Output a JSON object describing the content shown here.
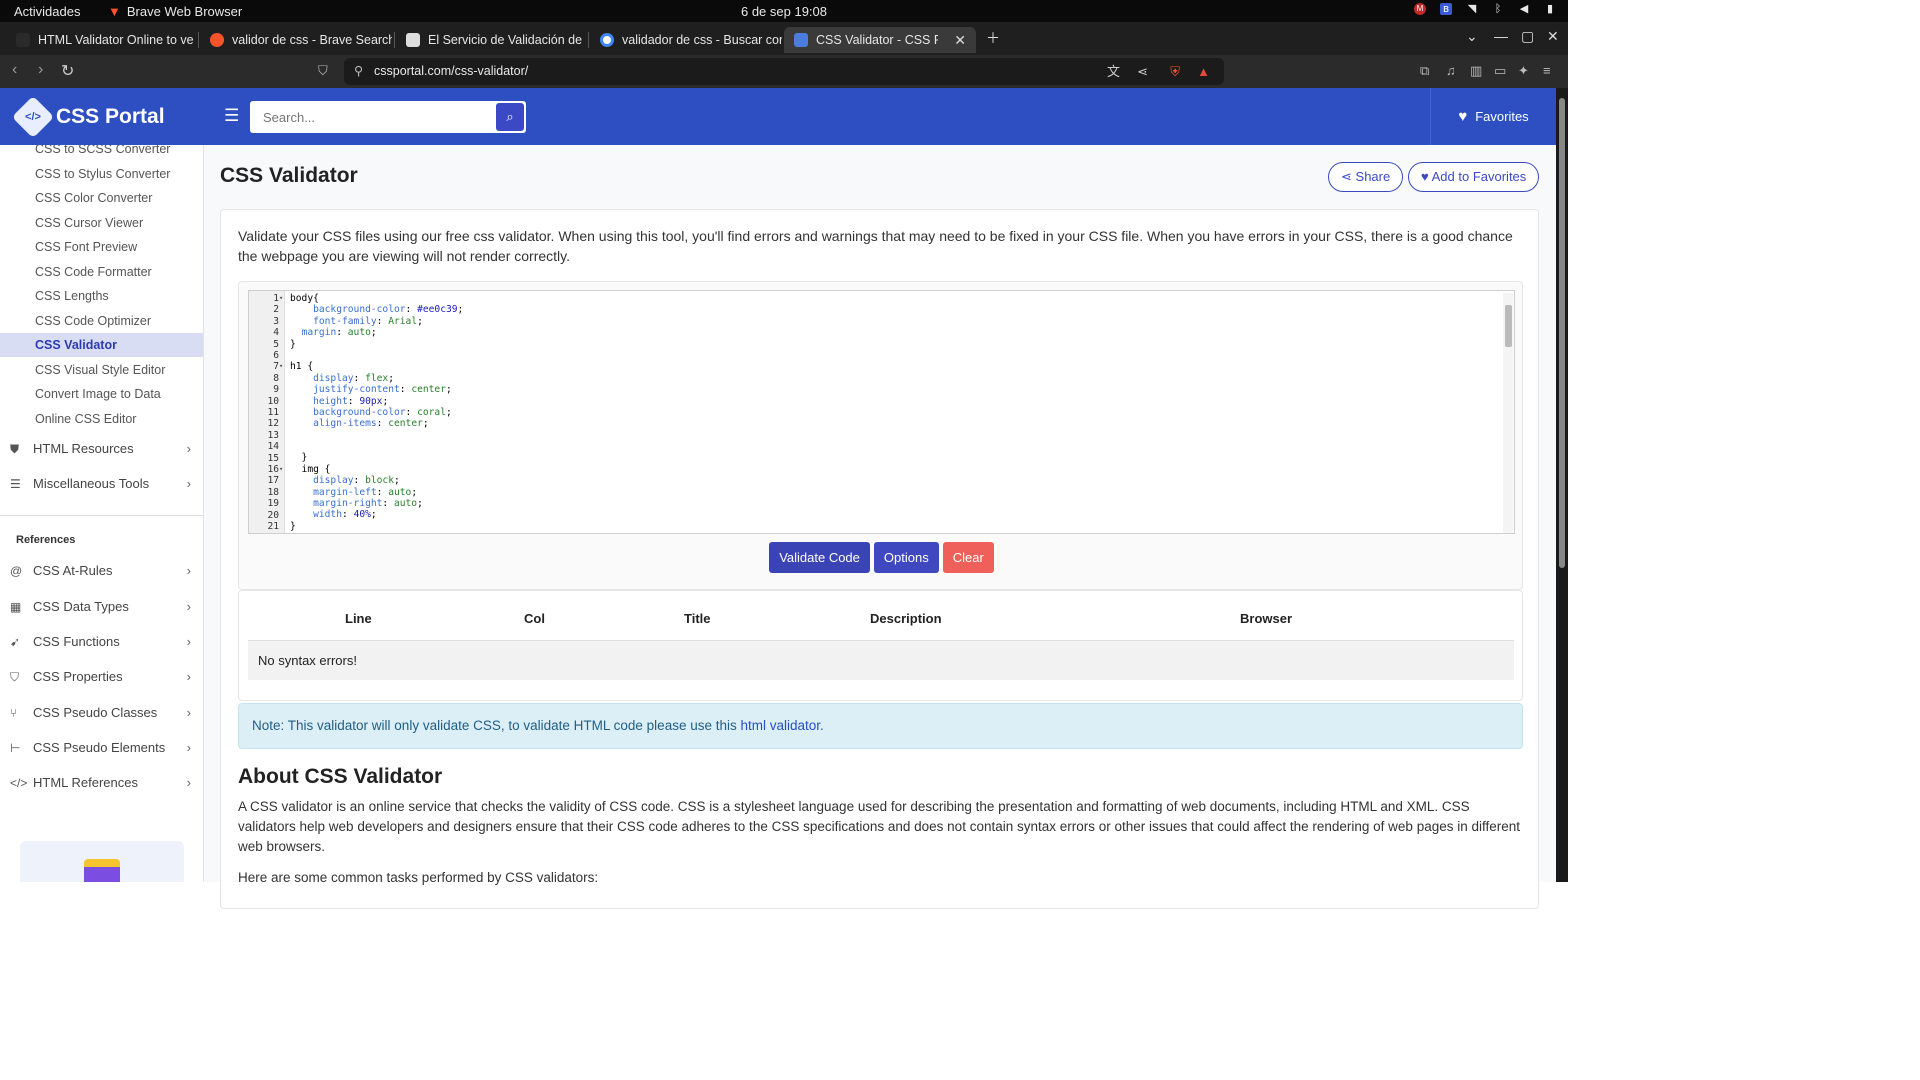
{
  "system": {
    "activities": "Actividades",
    "app_name": "Brave Web Browser",
    "clock": "6 de sep  19:08"
  },
  "tabs": [
    {
      "label": "HTML Validator Online to ve",
      "icon_color": "#e44d26"
    },
    {
      "label": "validor de css - Brave Search",
      "icon_color": "#fb542b"
    },
    {
      "label": "El Servicio de Validación de",
      "icon_color": "#dddddd"
    },
    {
      "label": "validador de css - Buscar cor",
      "icon_color": "#4285f4"
    },
    {
      "label": "CSS Validator - CSS Portal",
      "icon_color": "#4d7ce0",
      "active": true
    }
  ],
  "address": {
    "url": "cssportal.com/css-validator/"
  },
  "header": {
    "brand": "CSS Portal",
    "search_placeholder": "Search...",
    "favorites": "Favorites"
  },
  "sidebar": {
    "items": [
      "CSS to SCSS Converter",
      "CSS to Stylus Converter",
      "CSS Color Converter",
      "CSS Cursor Viewer",
      "CSS Font Preview",
      "CSS Code Formatter",
      "CSS Lengths",
      "CSS Code Optimizer",
      "CSS Validator",
      "CSS Visual Style Editor",
      "Convert Image to Data",
      "Online CSS Editor"
    ],
    "groups": [
      {
        "label": "HTML Resources",
        "icon": "html5-icon"
      },
      {
        "label": "Miscellaneous Tools",
        "icon": "list-icon"
      }
    ],
    "references_heading": "References",
    "references": [
      {
        "label": "CSS At-Rules",
        "icon": "at-icon"
      },
      {
        "label": "CSS Data Types",
        "icon": "table-icon"
      },
      {
        "label": "CSS Functions",
        "icon": "function-icon"
      },
      {
        "label": "CSS Properties",
        "icon": "css3-icon"
      },
      {
        "label": "CSS Pseudo Classes",
        "icon": "branch-icon"
      },
      {
        "label": "CSS Pseudo Elements",
        "icon": "sitemap-icon"
      },
      {
        "label": "HTML References",
        "icon": "code-icon"
      }
    ]
  },
  "page": {
    "title": "CSS Validator",
    "share": "Share",
    "add_favorites": "Add to Favorites",
    "intro": "Validate your CSS files using our free css validator. When using this tool, you'll find errors and warnings that may need to be fixed in your CSS file. When you have errors in your CSS, there is a good chance the webpage you are viewing will not render correctly.",
    "buttons": {
      "validate": "Validate Code",
      "options": "Options",
      "clear": "Clear"
    },
    "table": {
      "headers": [
        "Line",
        "Col",
        "Title",
        "Description",
        "Browser"
      ],
      "empty_message": "No syntax errors!"
    },
    "note_prefix": "Note: This validator will only validate CSS, to validate HTML code please use this ",
    "note_link": "html validator",
    "note_suffix": ".",
    "about_title": "About CSS Validator",
    "about_text": "A CSS validator is an online service that checks the validity of CSS code. CSS is a stylesheet language used for describing the presentation and formatting of web documents, including HTML and XML. CSS validators help web developers and designers ensure that their CSS code adheres to the CSS specifications and does not contain syntax errors or other issues that could affect the rendering of web pages in different web browsers.",
    "tasks_intro": "Here are some common tasks performed by CSS validators:"
  },
  "code_lines": [
    "1",
    "2",
    "3",
    "4",
    "5",
    "6",
    "7",
    "8",
    "9",
    "10",
    "11",
    "12",
    "13",
    "14",
    "15",
    "16",
    "17",
    "18",
    "19",
    "20",
    "21"
  ],
  "code": [
    [
      {
        "t": "body{"
      }
    ],
    [
      {
        "t": "    "
      },
      {
        "t": "background-color",
        "c": "k"
      },
      {
        "t": ": "
      },
      {
        "t": "#ee0c39",
        "c": "h"
      },
      {
        "t": ";"
      }
    ],
    [
      {
        "t": "    "
      },
      {
        "t": "font-family",
        "c": "k"
      },
      {
        "t": ": "
      },
      {
        "t": "Arial",
        "c": "v"
      },
      {
        "t": ";"
      }
    ],
    [
      {
        "t": "  "
      },
      {
        "t": "margin",
        "c": "k"
      },
      {
        "t": ": "
      },
      {
        "t": "auto",
        "c": "v"
      },
      {
        "t": ";"
      }
    ],
    [
      {
        "t": "}"
      }
    ],
    [
      {
        "t": ""
      }
    ],
    [
      {
        "t": "h1 {"
      }
    ],
    [
      {
        "t": "    "
      },
      {
        "t": "display",
        "c": "k"
      },
      {
        "t": ": "
      },
      {
        "t": "flex",
        "c": "v"
      },
      {
        "t": ";"
      }
    ],
    [
      {
        "t": "    "
      },
      {
        "t": "justify-content",
        "c": "k"
      },
      {
        "t": ": "
      },
      {
        "t": "center",
        "c": "v"
      },
      {
        "t": ";"
      }
    ],
    [
      {
        "t": "    "
      },
      {
        "t": "height",
        "c": "k"
      },
      {
        "t": ": "
      },
      {
        "t": "90px",
        "c": "h"
      },
      {
        "t": ";"
      }
    ],
    [
      {
        "t": "    "
      },
      {
        "t": "background-color",
        "c": "k"
      },
      {
        "t": ": "
      },
      {
        "t": "coral",
        "c": "v"
      },
      {
        "t": ";"
      }
    ],
    [
      {
        "t": "    "
      },
      {
        "t": "align-items",
        "c": "k"
      },
      {
        "t": ": "
      },
      {
        "t": "center",
        "c": "v"
      },
      {
        "t": ";"
      }
    ],
    [
      {
        "t": ""
      }
    ],
    [
      {
        "t": ""
      }
    ],
    [
      {
        "t": "  }"
      }
    ],
    [
      {
        "t": "  img {"
      }
    ],
    [
      {
        "t": "    "
      },
      {
        "t": "display",
        "c": "k"
      },
      {
        "t": ": "
      },
      {
        "t": "block",
        "c": "v"
      },
      {
        "t": ";"
      }
    ],
    [
      {
        "t": "    "
      },
      {
        "t": "margin-left",
        "c": "k"
      },
      {
        "t": ": "
      },
      {
        "t": "auto",
        "c": "v"
      },
      {
        "t": ";"
      }
    ],
    [
      {
        "t": "    "
      },
      {
        "t": "margin-right",
        "c": "k"
      },
      {
        "t": ": "
      },
      {
        "t": "auto",
        "c": "v"
      },
      {
        "t": ";"
      }
    ],
    [
      {
        "t": "    "
      },
      {
        "t": "width",
        "c": "k"
      },
      {
        "t": ": "
      },
      {
        "t": "40%",
        "c": "h"
      },
      {
        "t": ";"
      }
    ],
    [
      {
        "t": "}"
      }
    ]
  ],
  "fold_lines": [
    "1",
    "7",
    "16"
  ]
}
